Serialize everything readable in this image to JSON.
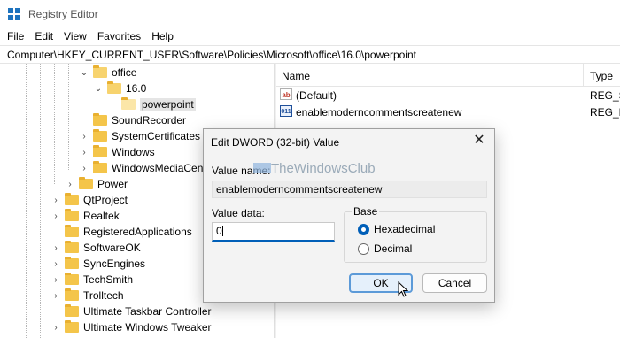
{
  "window": {
    "title": "Registry Editor"
  },
  "menu": [
    "File",
    "Edit",
    "View",
    "Favorites",
    "Help"
  ],
  "address": "Computer\\HKEY_CURRENT_USER\\Software\\Policies\\Microsoft\\office\\16.0\\powerpoint",
  "tree": [
    {
      "label": "office",
      "chevron": "v",
      "open": true
    },
    {
      "label": "16.0",
      "chevron": "v",
      "open": true
    },
    {
      "label": "powerpoint",
      "chevron": "",
      "selected": true
    },
    {
      "label": "SoundRecorder",
      "chevron": ""
    },
    {
      "label": "SystemCertificates",
      "chevron": ">"
    },
    {
      "label": "Windows",
      "chevron": ">"
    },
    {
      "label": "WindowsMediaCent",
      "chevron": ">"
    },
    {
      "label": "Power",
      "chevron": ">"
    },
    {
      "label": "QtProject",
      "chevron": ">"
    },
    {
      "label": "Realtek",
      "chevron": ">"
    },
    {
      "label": "RegisteredApplications",
      "chevron": ""
    },
    {
      "label": "SoftwareOK",
      "chevron": ">"
    },
    {
      "label": "SyncEngines",
      "chevron": ">"
    },
    {
      "label": "TechSmith",
      "chevron": ">"
    },
    {
      "label": "Trolltech",
      "chevron": ">"
    },
    {
      "label": "Ultimate Taskbar Controller",
      "chevron": ""
    },
    {
      "label": "Ultimate Windows Tweaker",
      "chevron": ">"
    }
  ],
  "values_pane": {
    "headers": {
      "name": "Name",
      "type": "Type"
    },
    "rows": [
      {
        "icon": "ab",
        "name": "(Default)",
        "type": "REG_SZ"
      },
      {
        "icon": "011",
        "name": "enablemoderncommentscreatenew",
        "type": "REG_D"
      }
    ]
  },
  "dialog": {
    "title": "Edit DWORD (32-bit) Value",
    "close": "✕",
    "value_name_label": "Value name:",
    "value_name": "enablemoderncommentscreatenew",
    "value_data_label": "Value data:",
    "value_data": "0",
    "base_label": "Base",
    "options": [
      "Hexadecimal",
      "Decimal"
    ],
    "selected_option": "Hexadecimal",
    "ok": "OK",
    "cancel": "Cancel",
    "watermark": "TheWindowsClub"
  }
}
